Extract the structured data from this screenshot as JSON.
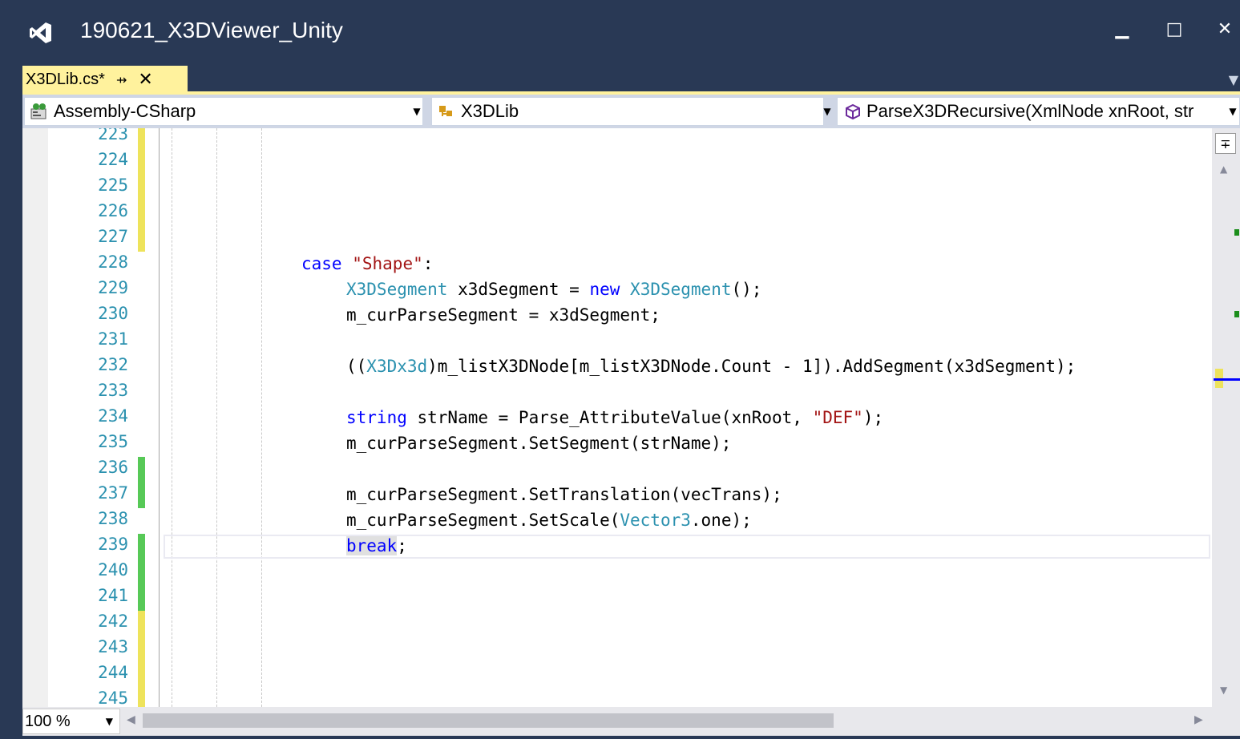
{
  "window": {
    "title": "190621_X3DViewer_Unity",
    "minimize": "▁",
    "maximize": "□",
    "close": "✕"
  },
  "tab": {
    "label": "X3DLib.cs*",
    "pin": "⇸",
    "close": "✕",
    "overflow": "▼"
  },
  "nav": {
    "project": "Assembly-CSharp",
    "class": "X3DLib",
    "member": "ParseX3DRecursive(XmlNode xnRoot, str",
    "dropdown": "▼"
  },
  "colors": {
    "titlebar": "#293955",
    "tab_active": "#fff29d",
    "keyword": "#0000ff",
    "type": "#2b91af",
    "string": "#a31515",
    "change_saved": "#57c957",
    "change_unsaved": "#eee35b"
  },
  "line_numbers": [
    "223",
    "224",
    "225",
    "226",
    "227",
    "228",
    "229",
    "230",
    "231",
    "232",
    "233",
    "234",
    "235",
    "236",
    "237",
    "238",
    "239",
    "240",
    "241",
    "242",
    "243",
    "244",
    "245"
  ],
  "code": {
    "l228": {
      "kw": "case",
      "sp": " ",
      "str": "\"Shape\"",
      "rest": ":"
    },
    "l229": {
      "type1": "X3DSegment",
      "mid": " x3dSegment = ",
      "kw": "new",
      "sp": " ",
      "type2": "X3DSegment",
      "rest": "();"
    },
    "l230": {
      "text": "m_curParseSegment = x3dSegment;"
    },
    "l232": {
      "pre": "((",
      "type": "X3Dx3d",
      "rest": ")m_listX3DNode[m_listX3DNode.Count - 1]).AddSegment(x3dSegment);"
    },
    "l234": {
      "kw": "string",
      "mid": " strName = Parse_AttributeValue(xnRoot, ",
      "str": "\"DEF\"",
      "rest": ");"
    },
    "l235": {
      "text": "m_curParseSegment.SetSegment(strName);"
    },
    "l237": {
      "text": "m_curParseSegment.SetTranslation(vecTrans);"
    },
    "l238": {
      "pre": "m_curParseSegment.SetScale(",
      "type": "Vector3",
      "rest": ".one);"
    },
    "l239": {
      "kw": "break",
      "rest": ";"
    }
  },
  "scrollbar": {
    "split": "∓",
    "up": "▲",
    "down": "▼"
  },
  "status": {
    "zoom": "100 %",
    "zoom_dd": "▼",
    "hscroll_left": "◀",
    "hscroll_right": "▶"
  }
}
